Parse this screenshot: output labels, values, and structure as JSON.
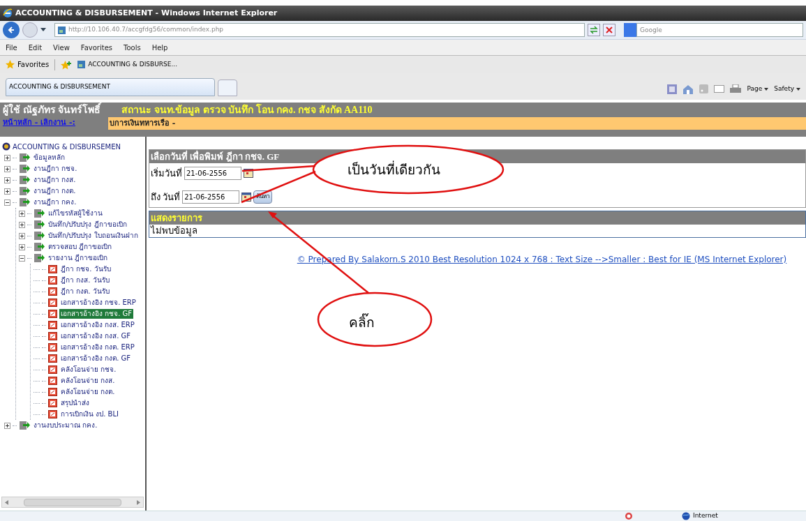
{
  "window": {
    "title": "ACCOUNTING & DISBURSEMENT - Windows Internet Explorer"
  },
  "address_bar": {
    "url": "http://10.106.40.7/accgfdg56/common/index.php",
    "search_placeholder": "Google"
  },
  "menu": [
    "File",
    "Edit",
    "View",
    "Favorites",
    "Tools",
    "Help"
  ],
  "favorites_bar": {
    "label": "Favorites",
    "items": [
      "ACCOUNTING & DISBURSE..."
    ]
  },
  "tabs": [
    {
      "label": "ACCOUNTING & DISBURSEMENT",
      "selected": true
    }
  ],
  "command_bar": [
    "Page",
    "Safety"
  ],
  "page": {
    "user": "ผู้ใช้ ณัฐภัทร จันทร์โพธิ์",
    "status": "สถานะ จนท.ข้อมูล ตรวจ บันทึก โอน กคง. กชจ สังกัด AA110",
    "nav_link": "หน้าหลัก - เลิกงาน -:",
    "banner": "บการเงินทหารเรือ -",
    "tree": {
      "root": "ACCOUNTING & DISBURSEMEN",
      "items": [
        {
          "label": "ข้อมูลหลัก",
          "selected": false,
          "expanded": false
        },
        {
          "label": "งานฎีกา กชจ.",
          "selected": false,
          "expanded": false
        },
        {
          "label": "งานฎีกา กงส.",
          "selected": false,
          "expanded": false
        },
        {
          "label": "งานฎีกา กงต.",
          "selected": false,
          "expanded": false
        },
        {
          "label": "งานฎีกา กคง.",
          "selected": false,
          "expanded": true,
          "children": [
            {
              "label": "แก้ไขรหัสผู้ใช้งาน",
              "selected": false,
              "expanded": false
            },
            {
              "label": "บันทึก/ปรับปรุง ฎีกาขอเบิก",
              "selected": false,
              "expanded": false
            },
            {
              "label": "บันทึก/ปรับปรุง ใบถอนเงินฝาก",
              "selected": false,
              "expanded": false
            },
            {
              "label": "ตรวจสอบ ฎีกาขอเบิก",
              "selected": false,
              "expanded": false
            },
            {
              "label": "รายงาน ฎีกาขอเบิก",
              "selected": false,
              "expanded": true,
              "children": [
                {
                  "label": "ฎีกา กชจ. วันรับ",
                  "selected": false
                },
                {
                  "label": "ฎีกา กงส. วันรับ",
                  "selected": false
                },
                {
                  "label": "ฎีกา กงต. วันรับ",
                  "selected": false
                },
                {
                  "label": "เอกสารอ้างอิง กชจ. ERP",
                  "selected": false
                },
                {
                  "label": "เอกสารอ้างอิง กชจ. GF",
                  "selected": true
                },
                {
                  "label": "เอกสารอ้างอิง กงส. ERP",
                  "selected": false
                },
                {
                  "label": "เอกสารอ้างอิง กงส. GF",
                  "selected": false
                },
                {
                  "label": "เอกสารอ้างอิง กงต. ERP",
                  "selected": false
                },
                {
                  "label": "เอกสารอ้างอิง กงต. GF",
                  "selected": false
                },
                {
                  "label": "คลังโอนจ่าย กชจ.",
                  "selected": false
                },
                {
                  "label": "คลังโอนจ่าย กงส.",
                  "selected": false
                },
                {
                  "label": "คลังโอนจ่าย กงต.",
                  "selected": false
                },
                {
                  "label": "สรุปนำส่ง",
                  "selected": false
                },
                {
                  "label": "การเบิกเงิน งป. BLI",
                  "selected": false
                }
              ]
            }
          ]
        },
        {
          "label": "งานงบประมาณ กคง.",
          "selected": false,
          "expanded": false
        }
      ]
    },
    "form": {
      "title": "เลือกวันที่ เพื่อพิมพ์ ฎีกา กชจ. GF",
      "fields": [
        {
          "label": "เริ่มวันที่",
          "value": "21-06-2556"
        },
        {
          "label": "ถึง วันที่",
          "value": "21-06-2556"
        }
      ],
      "button": "ค้นหา"
    },
    "results": {
      "title": "แสดงรายการ",
      "message": "ไม่พบข้อมูล"
    },
    "footer_link": "© Prepared By Salakorn.S 2010 Best Resolution 1024 x 768 : Text Size -->Smaller : Best for IE (MS Internet Explorer)"
  },
  "annotations": [
    {
      "text": "เป็นวันที่เดียวกัน"
    },
    {
      "text": "คลิ๊ก"
    }
  ],
  "status_bar": {
    "zone": "Internet"
  }
}
